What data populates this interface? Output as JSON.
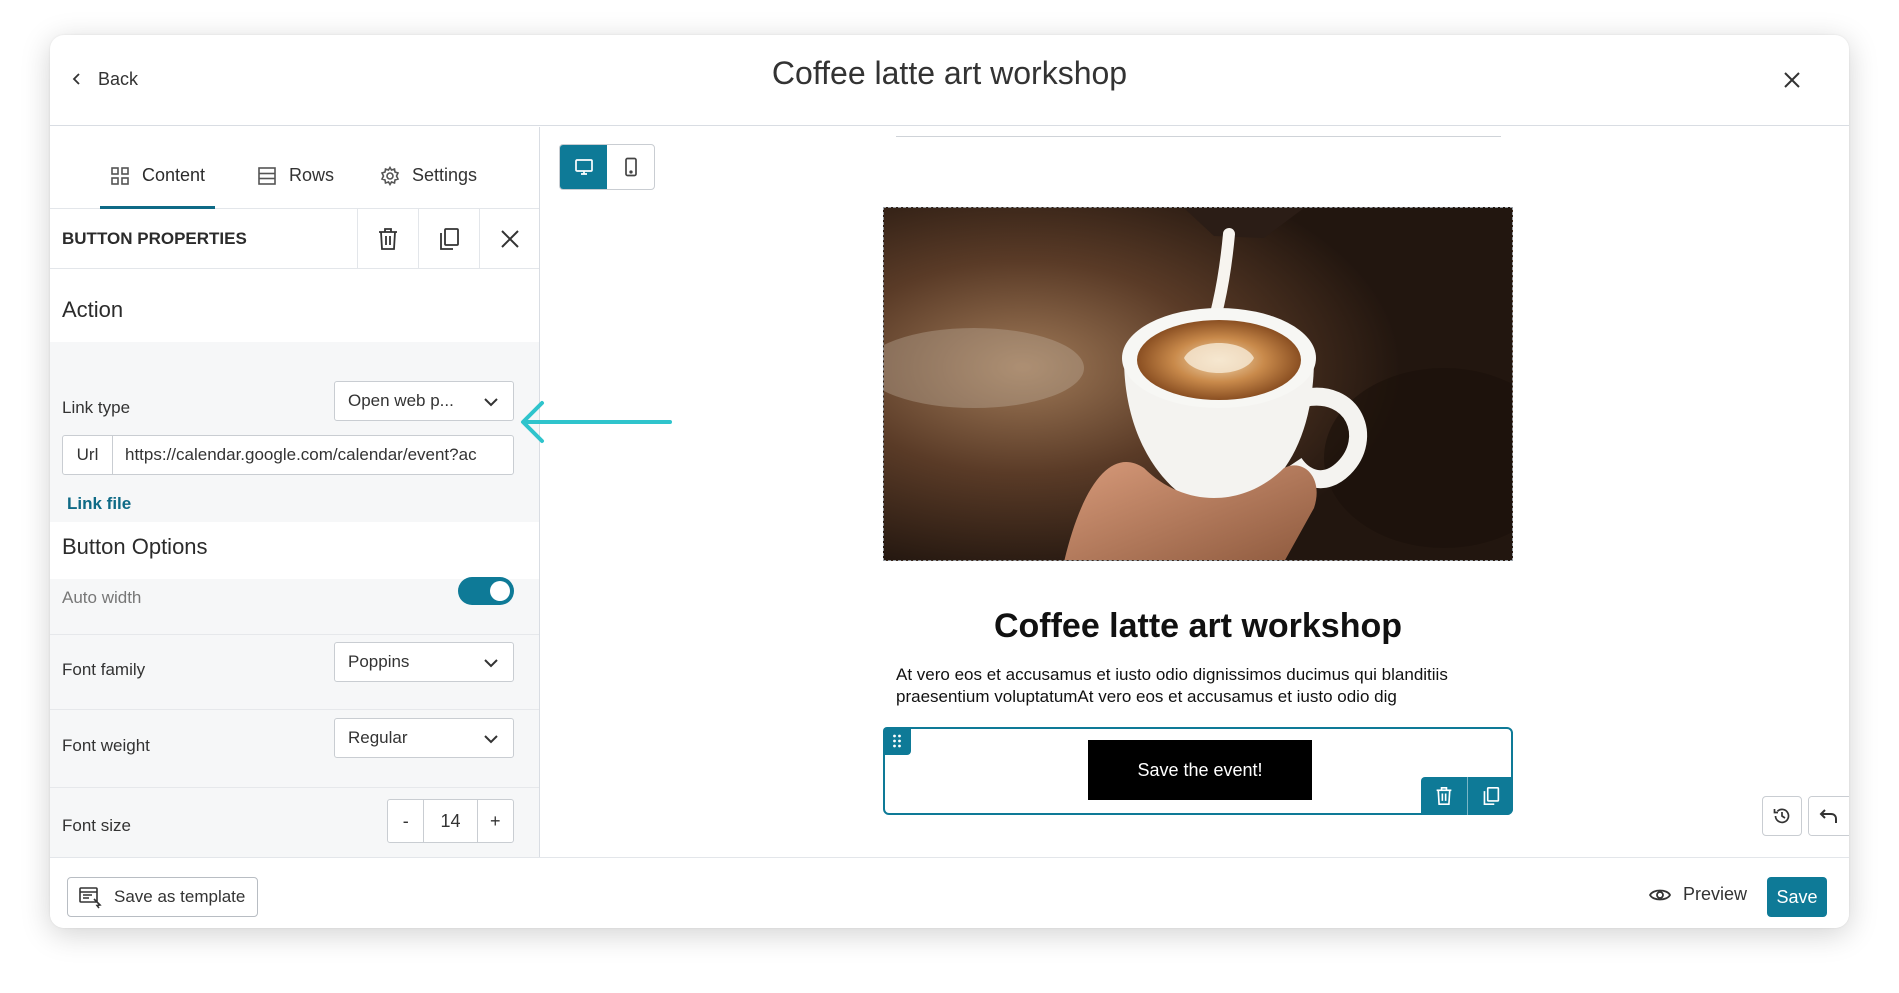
{
  "header": {
    "back_label": "Back",
    "title": "Coffee latte art workshop"
  },
  "tabs": [
    {
      "label": "Content",
      "icon": "grid-icon",
      "active": true
    },
    {
      "label": "Rows",
      "icon": "rows-icon",
      "active": false
    },
    {
      "label": "Settings",
      "icon": "gear-icon",
      "active": false
    }
  ],
  "properties": {
    "title": "BUTTON PROPERTIES"
  },
  "action": {
    "heading": "Action",
    "link_type_label": "Link type",
    "link_type_value": "Open web p...",
    "url_prefix": "Url",
    "url_value": "https://calendar.google.com/calendar/event?ac",
    "link_file": "Link file"
  },
  "button_options": {
    "heading": "Button Options",
    "auto_width_label": "Auto width",
    "auto_width_on": true,
    "font_family_label": "Font family",
    "font_family_value": "Poppins",
    "font_weight_label": "Font weight",
    "font_weight_value": "Regular",
    "font_size_label": "Font size",
    "font_size_minus": "-",
    "font_size_value": "14",
    "font_size_plus": "+"
  },
  "email": {
    "title": "Coffee latte art workshop",
    "body": "At vero eos et accusamus et iusto odio dignissimos ducimus qui blanditiis praesentium voluptatumAt vero eos et accusamus et iusto odio dig",
    "cta_label": "Save the event!"
  },
  "footer": {
    "save_template": "Save as template",
    "preview": "Preview",
    "save": "Save"
  },
  "colors": {
    "accent": "#0e7a97",
    "annotation_arrow": "#2fc4cc"
  }
}
